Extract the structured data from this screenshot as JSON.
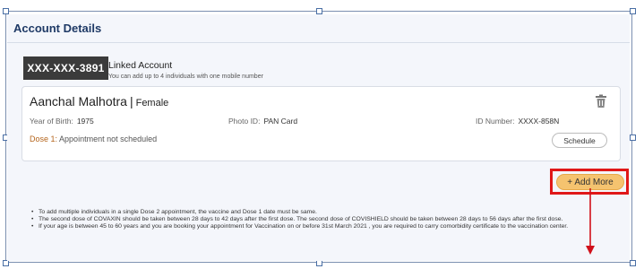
{
  "card": {
    "title": "Account Details"
  },
  "account": {
    "masked_number": "XXX-XXX-3891",
    "label": "Linked Account",
    "note": "You can add up to 4 individuals with one mobile number"
  },
  "beneficiary": {
    "name": "Aanchal Malhotra",
    "separator": "|",
    "gender": "Female",
    "year_of_birth_label": "Year of Birth:",
    "year_of_birth": "1975",
    "photo_id_label": "Photo ID:",
    "photo_id": "PAN Card",
    "id_number_label": "ID Number:",
    "id_number": "XXXX-858N",
    "dose_label": "Dose 1:",
    "dose_status": "Appointment not scheduled",
    "schedule_button": "Schedule",
    "delete_icon": "trash-icon"
  },
  "add_more_button": "+ Add More",
  "notes": [
    "To add multiple individuals in a single Dose 2 appointment, the vaccine and Dose 1 date must be same.",
    "The second dose of COVAXIN should be taken between 28 days to 42 days after the first dose. The second dose of COVISHIELD should be taken between 28 days to 56 days after the first dose.",
    "If your age is between 45 to 60 years and you are booking your appointment for Vaccination on or before 31st March 2021 , you are required to carry comorbidity certificate to the vaccination center."
  ],
  "colors": {
    "title": "#1f3a66",
    "badge": "#3b3b3b",
    "add_more": "#f5c36f",
    "highlight": "#e01818",
    "dose_label": "#b5651d"
  }
}
